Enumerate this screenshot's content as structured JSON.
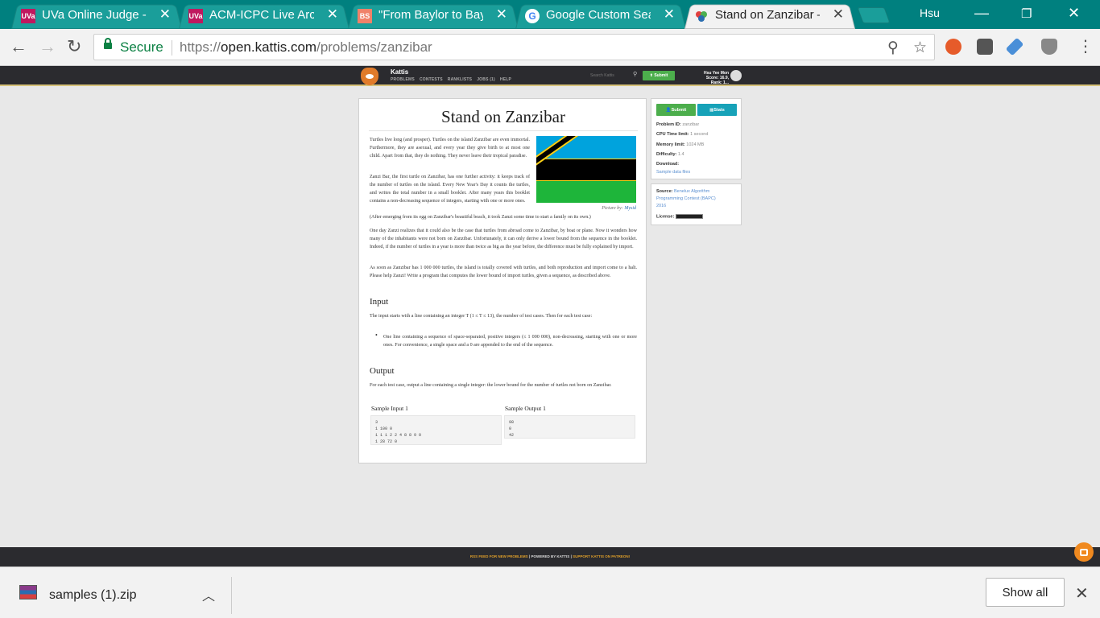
{
  "browser": {
    "tabs": [
      {
        "favicon": "UVa",
        "title": "UVa Online Judge - I",
        "color": "#c0185f"
      },
      {
        "favicon": "UVa",
        "title": "ACM-ICPC Live Arch",
        "color": "#c0185f"
      },
      {
        "favicon": "BS",
        "title": "\"From Baylor to Bayl",
        "color": "#f0826a"
      },
      {
        "favicon": "G",
        "title": "Google Custom Sear",
        "color": "#4285f4"
      },
      {
        "favicon": "kattis",
        "title": "Stand on Zanzibar –",
        "color": "#ffffff"
      }
    ],
    "profile_name": "Hsu",
    "secure_label": "Secure",
    "url_prefix": "https://",
    "url_host": "open.kattis.com",
    "url_path": "/problems/zanzibar"
  },
  "kattis_header": {
    "brand": "Kattis",
    "nav": [
      "PROBLEMS",
      "CONTESTS",
      "RANKLISTS",
      "JOBS (1)",
      "HELP"
    ],
    "search_placeholder": "Search Kattis",
    "submit_label": "Submit",
    "user_name": "Hsu Yee Mon",
    "user_score": "Score: 16.9, Rank: 1..."
  },
  "problem": {
    "title": "Stand on Zanzibar",
    "image_caption_prefix": "Picture by: ",
    "image_caption_author": "Mysid",
    "p1": "Turtles live long (and prosper). Turtles on the island Zanzibar are even immortal. Furthermore, they are asexual, and every year they give birth to at most one child. Apart from that, they do nothing. They never leave their tropical paradise.",
    "p2": "Zanzi Bar, the first turtle on Zanzibar, has one further activity: it keeps track of the number of turtles on the island. Every New Year's Day it counts the turtles, and writes the total number in a small booklet. After many years this booklet contains a non-decreasing sequence of integers, starting with one or more ones.",
    "p2b": "(After emerging from its egg on Zanzibar's beautiful beach, it took Zanzi some time to start a family on its own.)",
    "p3": "One day Zanzi realizes that it could also be the case that turtles from abroad come to Zanzibar, by boat or plane. Now it wonders how many of the inhabitants were not born on Zanzibar. Unfortunately, it can only derive a lower bound from the sequence in the booklet. Indeed, if the number of turtles in a year is more than twice as big as the year before, the difference must be fully explained by import.",
    "p4": "As soon as Zanzibar has 1 000 000 turtles, the island is totally covered with turtles, and both reproduction and import come to a halt. Please help Zanzi! Write a program that computes the lower bound of import turtles, given a sequence, as described above.",
    "input_heading": "Input",
    "input_text": "The input starts with a line containing an integer T (1 ≤ T ≤ 13), the number of test cases. Then for each test case:",
    "input_bullet": "One line containing a sequence of space-separated, positive integers (≤ 1 000 000), non-decreasing, starting with one or more ones. For convenience, a single space and a 0 are appended to the end of the sequence.",
    "output_heading": "Output",
    "output_text": "For each test case, output a line containing a single integer: the lower bound for the number of turtles not born on Zanzibar.",
    "sample_input_title": "Sample Input 1",
    "sample_input": "3\n1 100 0\n1 1 1 2 2 4 8 8 9 0\n1 28 72 0",
    "sample_output_title": "Sample Output 1",
    "sample_output": "98\n0\n42"
  },
  "sidebar": {
    "submit_label": "Submit",
    "stats_label": "Stats",
    "problem_id_label": "Problem ID:",
    "problem_id": "zanzibar",
    "cpu_label": "CPU Time limit:",
    "cpu": "1 second",
    "memory_label": "Memory limit:",
    "memory": "1024 MB",
    "difficulty_label": "Difficulty:",
    "difficulty": "1.4",
    "download_label": "Download:",
    "download_link": "Sample data files",
    "source_label": "Source:",
    "source_line1": "Benelux Algorithm",
    "source_line2": "Programming Contest (BAPC)",
    "source_line3": "2016",
    "license_label": "License:"
  },
  "footer": {
    "rss": "RSS FEED FOR NEW PROBLEMS",
    "powered": "POWERED BY KATTIS",
    "support": "SUPPORT KATTIS ON PATREON!"
  },
  "download_bar": {
    "file_name": "samples (1).zip",
    "show_all": "Show all"
  },
  "colors": {
    "tab_strip": "#00807f",
    "kattis_green": "#4cae4c",
    "kattis_teal": "#17a2b8",
    "secure_green": "#0b8043"
  }
}
